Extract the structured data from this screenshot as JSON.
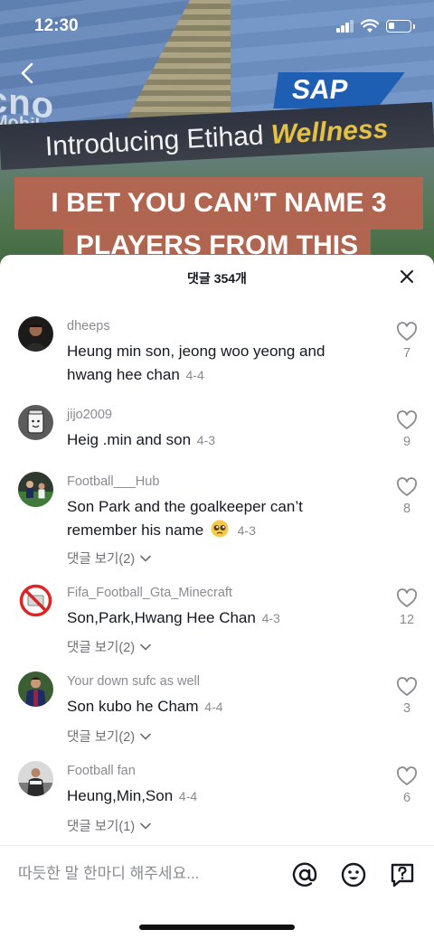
{
  "status_bar": {
    "time": "12:30",
    "battery_level": 0.3
  },
  "video": {
    "banner_left": "cno",
    "banner_left_sub": "Mobile",
    "sponsor_logo": "SAP",
    "sponsor_text": "Introducing Etihad",
    "sponsor_accent": "Wellness",
    "caption_line1": "I BET YOU CAN’T NAME 3",
    "caption_line2": "PLAYERS FROM THIS"
  },
  "comments_sheet": {
    "title": "댓글 354개",
    "comments": [
      {
        "username": "dheeps",
        "text": "Heung min son, jeong woo yeong and hwang hee chan",
        "date": "4-4",
        "likes": "7",
        "replies": ""
      },
      {
        "username": "jijo2009",
        "text": "Heig .min and son",
        "date": "4-3",
        "likes": "9",
        "replies": ""
      },
      {
        "username": "Football___Hub",
        "text": "Son Park and the goalkeeper can’t remember his name",
        "emoji": "pleading-face",
        "date": "4-3",
        "likes": "8",
        "replies": "댓글 보기(2)"
      },
      {
        "username": "Fifa_Football_Gta_Minecraft",
        "text": "Son,Park,Hwang Hee Chan",
        "date": "4-3",
        "likes": "12",
        "replies": "댓글 보기(2)"
      },
      {
        "username": "Your down sufc as well",
        "text": "Son kubo he Cham",
        "date": "4-4",
        "likes": "3",
        "replies": "댓글 보기(2)"
      },
      {
        "username": "Football fan",
        "text": "Heung,Min,Son",
        "date": "4-4",
        "likes": "6",
        "replies": "댓글 보기(1)"
      }
    ]
  },
  "input_bar": {
    "placeholder": "따듯한 말 한마디 해주세요...",
    "icons": [
      "mention-icon",
      "emoji-icon",
      "question-icon"
    ]
  },
  "colors": {
    "text_primary": "#161823",
    "text_secondary": "#8a8b91",
    "caption_bg": "#b86450"
  }
}
